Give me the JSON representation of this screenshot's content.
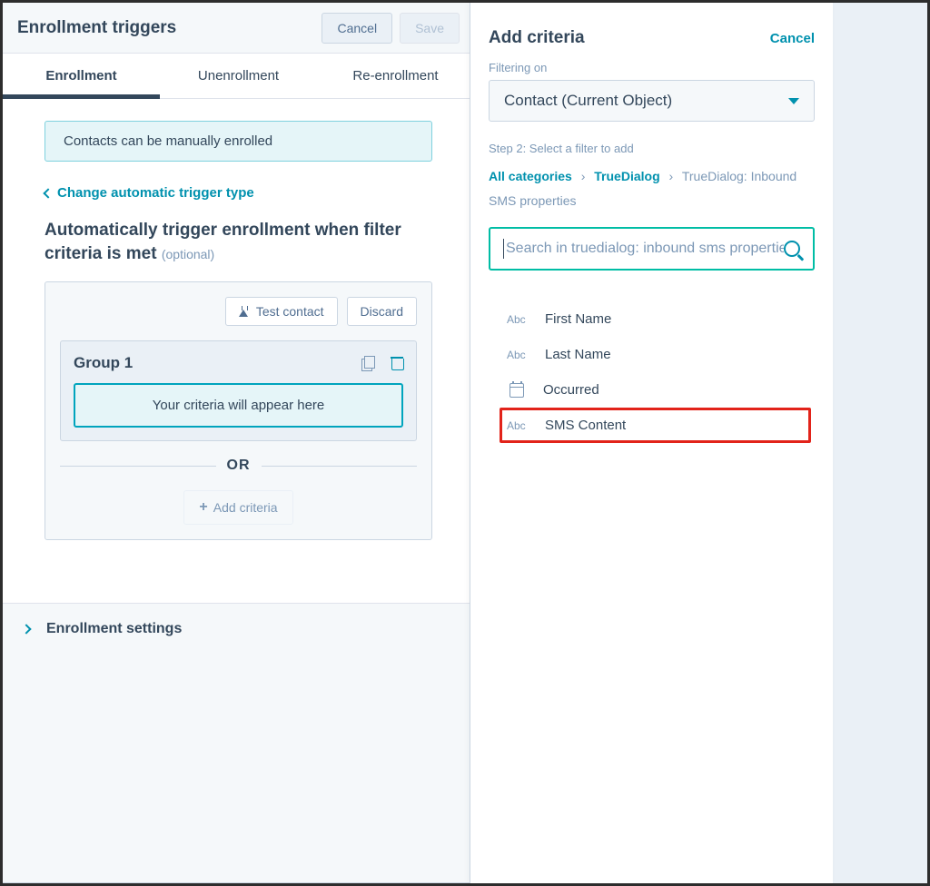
{
  "left": {
    "title": "Enrollment triggers",
    "cancel": "Cancel",
    "save": "Save",
    "tabs": [
      "Enrollment",
      "Unenrollment",
      "Re-enrollment"
    ],
    "info": "Contacts can be manually enrolled",
    "change_trigger": "Change automatic trigger type",
    "auto_title": "Automatically trigger enrollment when filter criteria is met ",
    "auto_optional": "(optional)",
    "test_contact": "Test contact",
    "discard": "Discard",
    "group_name": "Group 1",
    "criteria_placeholder": "Your criteria will appear here",
    "or": "OR",
    "add_criteria": "Add criteria",
    "settings": "Enrollment settings"
  },
  "right": {
    "title": "Add criteria",
    "cancel": "Cancel",
    "filtering_label": "Filtering on",
    "dropdown_value": "Contact (Current Object)",
    "step_label": "Step 2: Select a filter to add",
    "crumbs": {
      "all": "All categories",
      "cat": "TrueDialog",
      "sub": "TrueDialog: Inbound SMS properties"
    },
    "search_placeholder": "Search in truedialog: inbound sms properties",
    "props": [
      {
        "type": "abc",
        "label": "First Name"
      },
      {
        "type": "abc",
        "label": "Last Name"
      },
      {
        "type": "cal",
        "label": "Occurred"
      },
      {
        "type": "abc",
        "label": "SMS Content"
      }
    ],
    "abc_badge": "Abc"
  }
}
